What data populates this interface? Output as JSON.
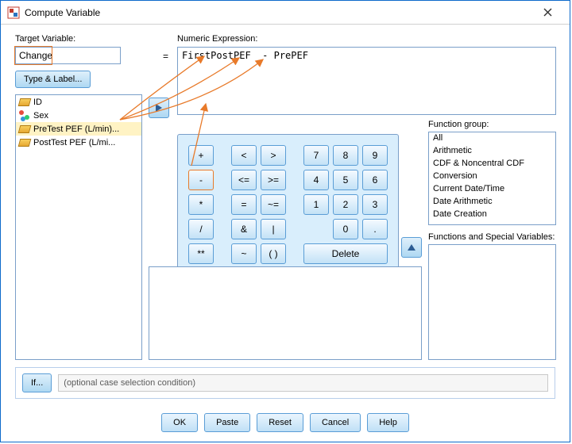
{
  "window": {
    "title": "Compute Variable"
  },
  "labels": {
    "target": "Target Variable:",
    "expression": "Numeric Expression:",
    "equals": "=",
    "type_label": "Type & Label...",
    "function_group": "Function group:",
    "functions_vars": "Functions and Special Variables:",
    "if": "If...",
    "cond_text": "(optional case selection condition)"
  },
  "target_value": "Change",
  "expression_value": "FirstPostPEF  - PrePEF",
  "variables": [
    {
      "name": "ID",
      "icon": "ruler"
    },
    {
      "name": "Sex",
      "icon": "nominal"
    },
    {
      "name": "PreTest PEF (L/min)...",
      "icon": "ruler",
      "selected": true
    },
    {
      "name": "PostTest PEF (L/mi...",
      "icon": "ruler"
    }
  ],
  "keypad": {
    "rows": [
      [
        "+",
        "",
        "<",
        ">",
        "",
        "7",
        "8",
        "9"
      ],
      [
        "-",
        "",
        "<=",
        ">=",
        "",
        "4",
        "5",
        "6"
      ],
      [
        "*",
        "",
        "=",
        "~=",
        "",
        "1",
        "2",
        "3"
      ],
      [
        "/",
        "",
        "&",
        "|",
        "",
        "",
        "0",
        "."
      ],
      [
        "**",
        "",
        "~",
        "( )",
        "",
        "Delete",
        "",
        ""
      ]
    ],
    "highlight": "-",
    "delete": "Delete"
  },
  "function_groups": [
    "All",
    "Arithmetic",
    "CDF & Noncentral CDF",
    "Conversion",
    "Current Date/Time",
    "Date Arithmetic",
    "Date Creation"
  ],
  "buttons": {
    "ok": "OK",
    "paste": "Paste",
    "reset": "Reset",
    "cancel": "Cancel",
    "help": "Help"
  }
}
